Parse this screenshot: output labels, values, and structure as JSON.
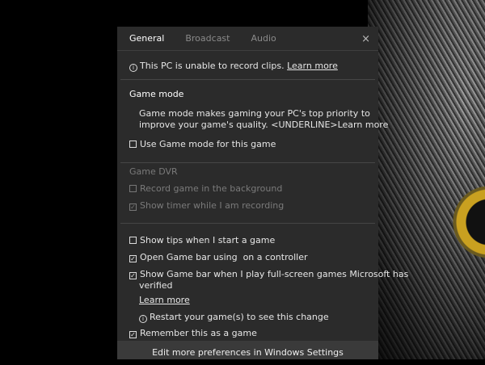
{
  "tabs": [
    "General",
    "Broadcast",
    "Audio"
  ],
  "close_icon": "×",
  "notice": {
    "text": "This PC is unable to record clips.",
    "link": "Learn more"
  },
  "game_mode": {
    "heading": "Game mode",
    "desc1": "Game mode makes gaming your PC's top priority to",
    "desc2": "improve your game's quality. <UNDERLINE>Learn more",
    "checkbox": "Use Game mode for this game",
    "checked": false
  },
  "game_dvr": {
    "heading": "Game DVR",
    "items": [
      {
        "label": "Record game in the background",
        "checked": false
      },
      {
        "label": "Show timer while I am recording",
        "checked": true
      }
    ]
  },
  "options": [
    {
      "label": "Show tips when I start a game",
      "checked": false
    },
    {
      "label": "Open Game bar using  on a controller",
      "checked": true
    },
    {
      "label": "Show Game bar when I play full-screen games Microsoft has",
      "label2": "verified",
      "checked": true
    }
  ],
  "learn_more": "Learn more",
  "restart_note": "Restart your game(s) to see this change",
  "remember": {
    "label": "Remember this as a game",
    "checked": true
  },
  "footer": "Edit more preferences in Windows Settings"
}
